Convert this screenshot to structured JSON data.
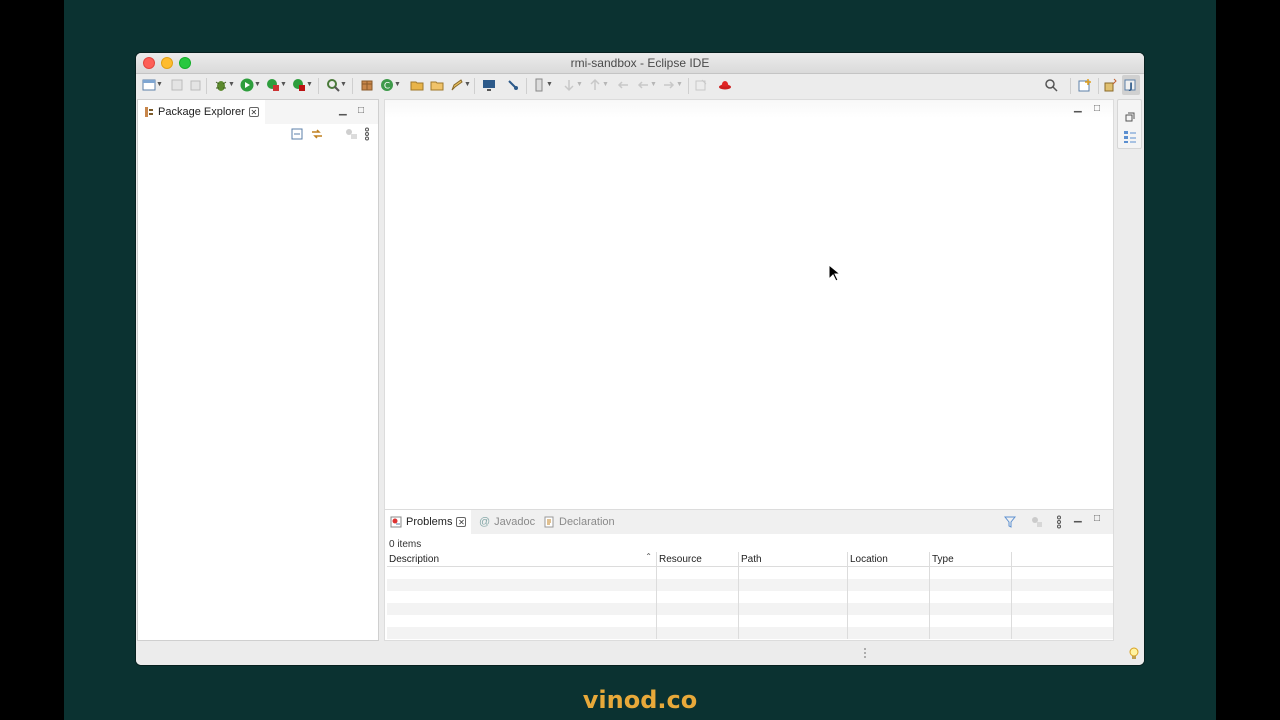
{
  "window": {
    "title": "rmi-sandbox - Eclipse IDE"
  },
  "package_explorer": {
    "tab_label": "Package Explorer"
  },
  "bottom_panel": {
    "tabs": [
      {
        "label": "Problems",
        "active": true
      },
      {
        "label": "Javadoc",
        "active": false
      },
      {
        "label": "Declaration",
        "active": false
      }
    ],
    "items_count": "0 items",
    "columns": [
      "Description",
      "Resource",
      "Path",
      "Location",
      "Type"
    ],
    "rows": 5
  },
  "watermark": {
    "text": "vinod.co",
    "color": "#e8a93a"
  },
  "colors": {
    "background": "#0b3231",
    "window": "#ececec"
  }
}
